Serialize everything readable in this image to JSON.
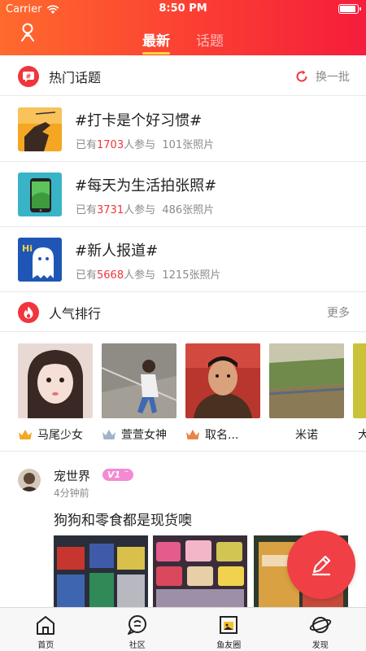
{
  "status_bar": {
    "carrier": "Carrier",
    "time": "8:50 PM"
  },
  "header": {
    "tabs": [
      {
        "label": "最新",
        "active": true
      },
      {
        "label": "话题",
        "active": false
      }
    ]
  },
  "hot_topics": {
    "title": "热门话题",
    "refresh_label": "换一批",
    "items": [
      {
        "title": "#打卡是个好习惯#",
        "prefix": "已有",
        "count": "1703",
        "suffix": "人参与",
        "photos": "101张照片"
      },
      {
        "title": "#每天为生活拍张照#",
        "prefix": "已有",
        "count": "3731",
        "suffix": "人参与",
        "photos": "486张照片"
      },
      {
        "title": "#新人报道#",
        "prefix": "已有",
        "count": "5668",
        "suffix": "人参与",
        "photos": "1215张照片"
      }
    ],
    "thumb_text": {
      "hi": "Hi"
    }
  },
  "ranking": {
    "title": "人气排行",
    "more_label": "更多",
    "items": [
      {
        "name": "马尾少女",
        "crown": "gold"
      },
      {
        "name": "萱萱女神",
        "crown": "silver"
      },
      {
        "name": "取名...",
        "crown": "bronze"
      },
      {
        "name": "米诺",
        "crown": "none"
      },
      {
        "name": "大",
        "crown": "none"
      }
    ]
  },
  "post": {
    "username": "宠世界",
    "badge": "V1",
    "time": "4分钟前",
    "text": "狗狗和零食都是现货噢"
  },
  "bottom_nav": [
    {
      "label": "首页",
      "icon": "home-icon"
    },
    {
      "label": "社区",
      "icon": "chat-icon"
    },
    {
      "label": "鱼友圈",
      "icon": "photo-frame-icon"
    },
    {
      "label": "发现",
      "icon": "planet-icon"
    }
  ],
  "colors": {
    "accent": "#f0353c",
    "header_start": "#ff6a2d",
    "header_end": "#f51d3c",
    "tab_underline": "#ffd53a",
    "badge": "#f48bd2"
  }
}
